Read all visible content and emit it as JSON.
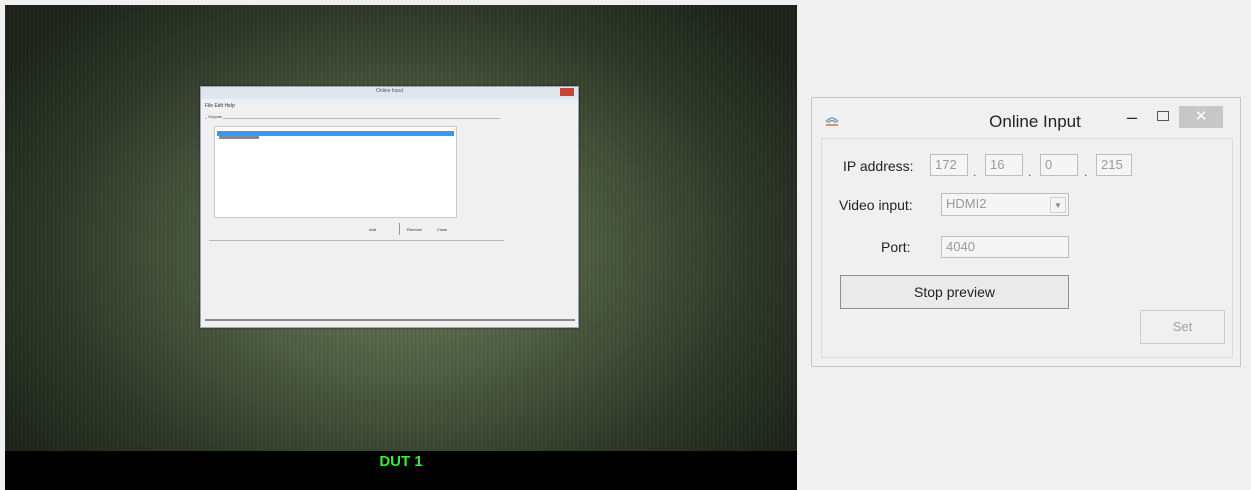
{
  "preview": {
    "status_label": "DUT 1",
    "status_color": "#33ee33",
    "captured_window": {
      "title": "Online Input",
      "menu": "File  Edit  Help",
      "group_label": "Outputs",
      "buttons": [
        "Add",
        "Remove",
        "Close"
      ]
    }
  },
  "dialog": {
    "title": "Online Input",
    "icons": {
      "app": "network-icon",
      "minimize": "minimize-icon",
      "maximize": "maximize-icon",
      "close": "close-icon"
    },
    "ip_label": "IP address:",
    "ip": [
      "172",
      "16",
      "0",
      "215"
    ],
    "video_label": "Video input:",
    "video_value": "HDMI2",
    "port_label": "Port:",
    "port_value": "4040",
    "stop_label": "Stop preview",
    "set_label": "Set"
  }
}
